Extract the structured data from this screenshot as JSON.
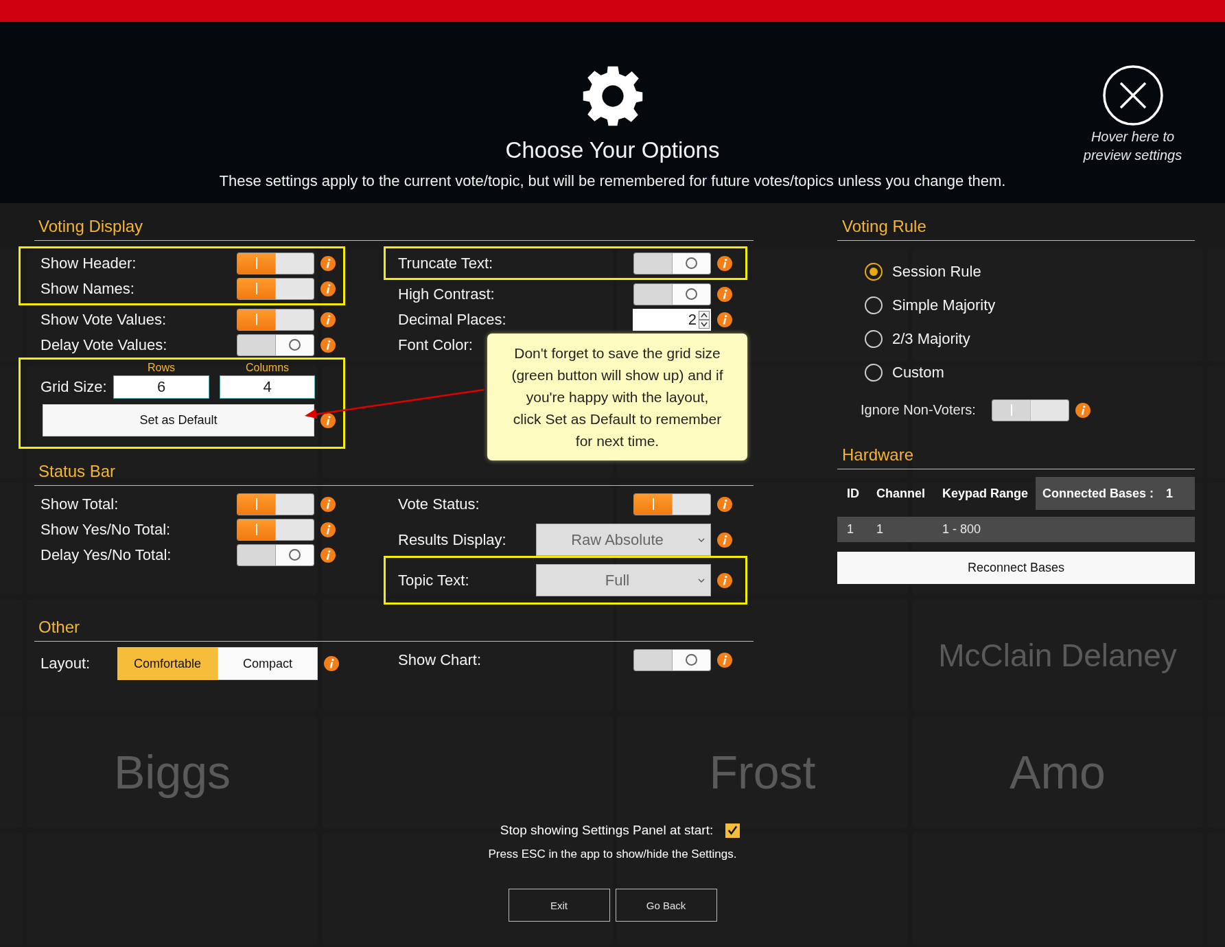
{
  "header": {
    "title": "Choose Your Options",
    "subtitle": "These settings apply to the current vote/topic, but will be remembered for future votes/topics unless you change them.",
    "close_hint": "Hover here to preview settings"
  },
  "sections": [
    {
      "title": "Voting Display",
      "left": [
        {
          "kind": "frame",
          "items": [
            {
              "kind": "toggle",
              "label": "Show Header:",
              "on": true,
              "info": true
            },
            {
              "kind": "toggle",
              "label": "Show Names:",
              "on": true,
              "info": true
            }
          ]
        },
        {
          "kind": "toggle",
          "label": "Show Vote Values:",
          "on": true,
          "info": true
        },
        {
          "kind": "toggle",
          "label": "Delay Vote Values:",
          "on": false,
          "info": true
        },
        {
          "kind": "frame",
          "items": [
            {
              "kind": "grid_size",
              "label": "Grid Size:",
              "fields": [
                {
                  "caption": "Rows",
                  "value": "6"
                },
                {
                  "caption": "Columns",
                  "value": "4"
                }
              ]
            },
            {
              "kind": "button",
              "label": "Set as Default",
              "info": true
            }
          ]
        }
      ],
      "right": [
        {
          "kind": "frame",
          "items": [
            {
              "kind": "toggle",
              "label": "Truncate Text:",
              "on": false,
              "info": true
            }
          ]
        },
        {
          "kind": "toggle",
          "label": "High Contrast:",
          "on": false,
          "info": true
        },
        {
          "kind": "number",
          "label": "Decimal Places:",
          "value": "2",
          "info": true
        },
        {
          "kind": "color",
          "label": "Font Color:"
        }
      ]
    },
    {
      "title": "Status Bar",
      "left": [
        {
          "kind": "toggle",
          "label": "Show Total:",
          "on": true,
          "info": true
        },
        {
          "kind": "toggle",
          "label": "Show Yes/No Total:",
          "on": true,
          "info": true
        },
        {
          "kind": "toggle",
          "label": "Delay Yes/No Total:",
          "on": false,
          "info": true
        }
      ],
      "right": [
        {
          "kind": "toggle",
          "label": "Vote Status:",
          "on": true,
          "info": true
        },
        {
          "kind": "dropdown",
          "label": "Results Display:",
          "value": "Raw Absolute",
          "info": true
        },
        {
          "kind": "frame",
          "items": [
            {
              "kind": "dropdown",
              "label": "Topic Text:",
              "value": "Full",
              "info": true
            }
          ]
        }
      ]
    },
    {
      "title": "Other",
      "left": [
        {
          "kind": "segmented",
          "label": "Layout:",
          "options": [
            {
              "label": "Comfortable",
              "selected": true
            },
            {
              "label": "Compact",
              "selected": false
            }
          ],
          "info": true
        }
      ],
      "right": [
        {
          "kind": "toggle",
          "label": "Show Chart:",
          "on": false,
          "info": true
        }
      ]
    }
  ],
  "voting_rule": {
    "title": "Voting Rule",
    "options": [
      {
        "label": "Session Rule",
        "selected": true
      },
      {
        "label": "Simple Majority",
        "selected": false
      },
      {
        "label": "2/3 Majority",
        "selected": false
      },
      {
        "label": "Custom",
        "selected": false
      }
    ],
    "ignore_non_voters": {
      "label": "Ignore Non-Voters:",
      "on": true,
      "disabled": true,
      "info": true
    }
  },
  "hardware": {
    "title": "Hardware",
    "columns": [
      "ID",
      "Channel",
      "Keypad Range"
    ],
    "connected_label": "Connected Bases :",
    "connected_count": "1",
    "rows": [
      [
        "1",
        "1",
        "1 - 800"
      ]
    ],
    "button": "Reconnect Bases"
  },
  "callout": {
    "text": "Don't forget to save the grid size (green button will show up) and if you're happy with the layout, click Set as Default to remember for next time."
  },
  "footer": {
    "checkbox": {
      "label": "Stop showing Settings Panel at start:",
      "checked": true
    },
    "hint": "Press ESC in the app to show/hide the Settings.",
    "buttons": [
      "Exit",
      "Go Back"
    ]
  },
  "background_names": [
    {
      "name": "McClain Delaney"
    },
    {
      "name": "Biggs"
    },
    {
      "name": "Frost"
    },
    {
      "name": "Amo"
    }
  ]
}
